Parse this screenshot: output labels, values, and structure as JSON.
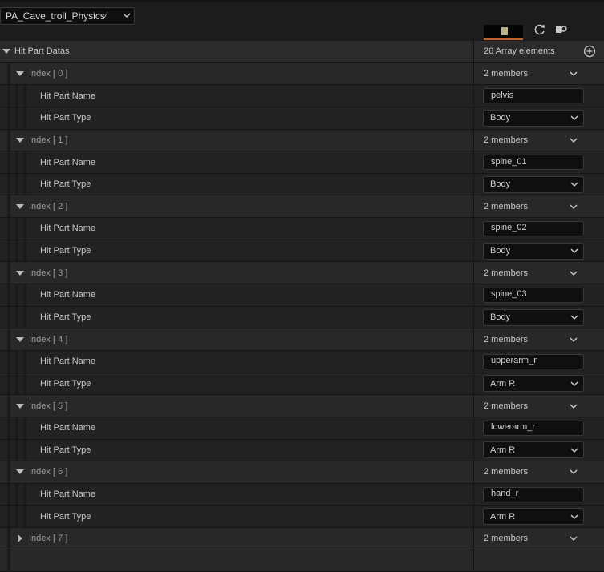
{
  "toolbar": {
    "asset_name": "PA_Cave_troll_Physics⁄",
    "asset_chevron": "chevron-down-icon",
    "icons": [
      "thumbnail",
      "refresh-icon",
      "browse-icon"
    ]
  },
  "property": {
    "name": "Hit Part Datas",
    "summary": "26 Array elements",
    "add_icon": "add-element-icon"
  },
  "labels": {
    "member_name": "Hit Part Name",
    "member_type": "Hit Part Type",
    "members_summary": "2 members"
  },
  "elements": [
    {
      "index_label": "Index [ 0 ]",
      "expanded": true,
      "name": "pelvis",
      "type": "Body"
    },
    {
      "index_label": "Index [ 1 ]",
      "expanded": true,
      "name": "spine_01",
      "type": "Body"
    },
    {
      "index_label": "Index [ 2 ]",
      "expanded": true,
      "name": "spine_02",
      "type": "Body"
    },
    {
      "index_label": "Index [ 3 ]",
      "expanded": true,
      "name": "spine_03",
      "type": "Body"
    },
    {
      "index_label": "Index [ 4 ]",
      "expanded": true,
      "name": "upperarm_r",
      "type": "Arm R"
    },
    {
      "index_label": "Index [ 5 ]",
      "expanded": true,
      "name": "lowerarm_r",
      "type": "Arm R"
    },
    {
      "index_label": "Index [ 6 ]",
      "expanded": true,
      "name": "hand_r",
      "type": "Arm R"
    },
    {
      "index_label": "Index [ 7 ]",
      "expanded": false
    }
  ],
  "colors": {
    "background": "#1a1a1a",
    "row_header": "#2b2b2b",
    "row_index": "#282828",
    "row_member": "#222222",
    "input_bg": "#0f0f0f",
    "text": "#c8c8c8",
    "thumbnail_accent": "#c0602a"
  }
}
